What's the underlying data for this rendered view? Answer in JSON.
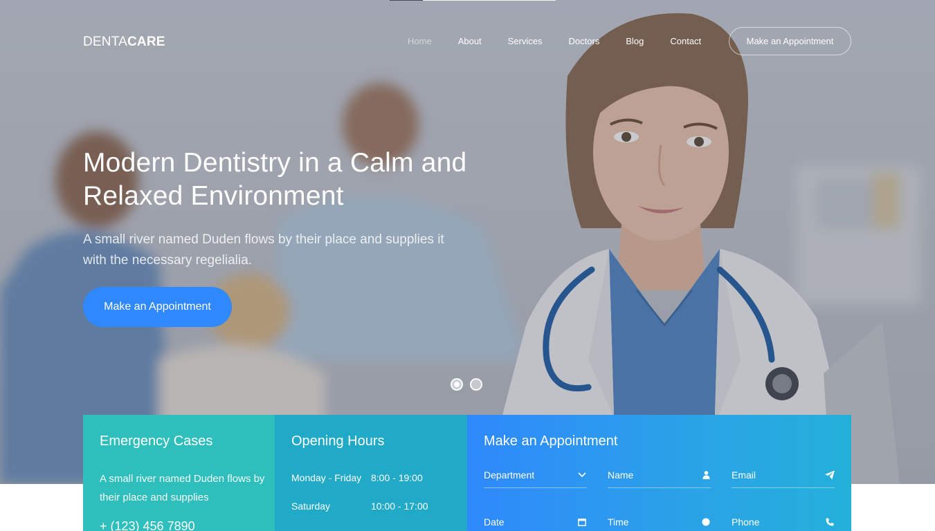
{
  "brand": {
    "thin": "DENTA",
    "bold": "CARE"
  },
  "nav": {
    "items": [
      {
        "label": "Home",
        "active": true
      },
      {
        "label": "About"
      },
      {
        "label": "Services"
      },
      {
        "label": "Doctors"
      },
      {
        "label": "Blog"
      },
      {
        "label": "Contact"
      }
    ],
    "cta_label": "Make an Appointment"
  },
  "hero": {
    "title": "Modern Dentistry in a Calm and Relaxed Environment",
    "subtitle": "A small river named Duden flows by their place and supplies it with the necessary regelialia.",
    "cta_label": "Make an Appointment",
    "slides": 2,
    "active_slide": 1
  },
  "emergency": {
    "title": "Emergency Cases",
    "text": "A small river named Duden flows by their place and supplies",
    "phone": "+ (123) 456 7890"
  },
  "hours": {
    "title": "Opening Hours",
    "rows": [
      {
        "day": "Monday - Friday",
        "time": "8:00 - 19:00"
      },
      {
        "day": "Saturday",
        "time": "10:00 - 17:00"
      }
    ]
  },
  "appointment": {
    "title": "Make an Appointment",
    "fields": {
      "department": {
        "label": "Department",
        "icon": "chevron-down-icon"
      },
      "name": {
        "label": "Name",
        "icon": "user-icon"
      },
      "email": {
        "label": "Email",
        "icon": "paper-plane-icon"
      },
      "date": {
        "label": "Date",
        "icon": "calendar-icon"
      },
      "time": {
        "label": "Time",
        "icon": "clock-icon"
      },
      "phone": {
        "label": "Phone",
        "icon": "phone-icon"
      }
    }
  },
  "colors": {
    "accent_blue": "#2f89fc",
    "teal": "#2ebfbd",
    "cyan": "#21a9c8"
  }
}
